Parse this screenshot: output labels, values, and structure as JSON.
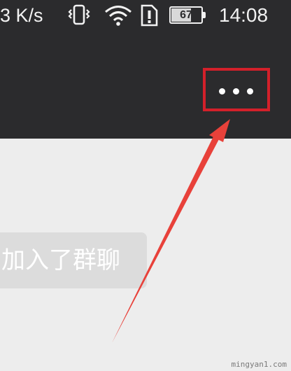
{
  "status_bar": {
    "network_speed": "3 K/s",
    "battery_level": 67,
    "battery_label": "67",
    "time": "14:08",
    "icons": [
      "vibrate-icon",
      "wifi-icon",
      "sim-alert-icon",
      "battery-icon"
    ]
  },
  "header": {
    "more_button_icon": "more-dots-icon",
    "highlight_color": "#d3202a"
  },
  "chat": {
    "system_message": "加入了群聊"
  },
  "annotation": {
    "arrow_color": "#e8413a"
  },
  "watermark": "mingyan1.com",
  "colors": {
    "titlebar": "#2b2b2d",
    "chat_background": "#ededed"
  }
}
